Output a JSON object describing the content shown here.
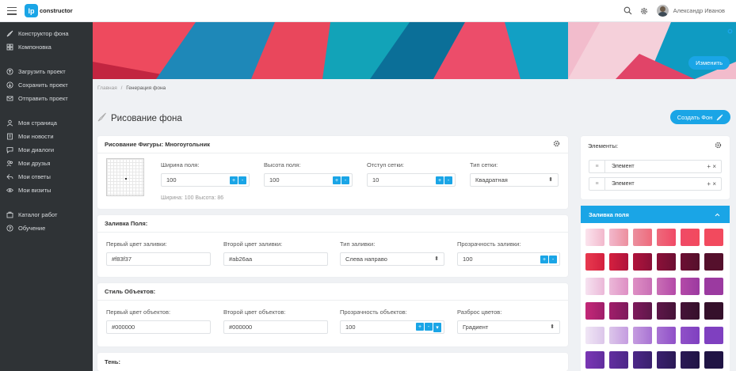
{
  "header": {
    "logo_letters": "lp",
    "logo_text": "constructor",
    "user_name": "Александр Иванов",
    "icons": [
      "search-icon",
      "settings-icon",
      "avatar"
    ]
  },
  "sidebar": {
    "items": [
      {
        "icon": "paint-brush-icon",
        "label": "Конструктор фона"
      },
      {
        "icon": "grid-icon",
        "label": "Компоновка"
      },
      {
        "icon": "upload-icon",
        "label": "Загрузить проект"
      },
      {
        "icon": "save-icon",
        "label": "Сохранить проект"
      },
      {
        "icon": "send-icon",
        "label": "Отправить проект"
      },
      {
        "icon": "user-icon",
        "label": "Моя страница"
      },
      {
        "icon": "news-icon",
        "label": "Мои новости"
      },
      {
        "icon": "chat-icon",
        "label": "Мои диалоги"
      },
      {
        "icon": "friends-icon",
        "label": "Мои друзья"
      },
      {
        "icon": "reply-icon",
        "label": "Мои ответы"
      },
      {
        "icon": "eye-icon",
        "label": "Мои визиты"
      },
      {
        "icon": "catalog-icon",
        "label": "Каталог работ"
      },
      {
        "icon": "help-icon",
        "label": "Обучение"
      }
    ]
  },
  "hero": {
    "change_button": "Изменить"
  },
  "breadcrumb": {
    "home": "Главная",
    "separator": "/",
    "current": "Генерация фона"
  },
  "page": {
    "title": "Рисование фона",
    "create_button": "Создать Фон"
  },
  "drawing": {
    "title": "Рисование Фигуры: Многоугольник",
    "field_width_label": "Ширина поля:",
    "field_width_value": "100",
    "field_height_label": "Высота поля:",
    "field_height_value": "100",
    "grid_offset_label": "Отступ сетки:",
    "grid_offset_value": "10",
    "grid_type_label": "Тип сетки:",
    "grid_type_value": "Квадратная",
    "size_hint": "Ширина: 100 Высота: 86"
  },
  "fill": {
    "title": "Заливка Поля:",
    "first_color_label": "Первый цвет заливки:",
    "first_color_value": "#f83f37",
    "second_color_label": "Второй цвет заливки:",
    "second_color_value": "#ab26aa",
    "fill_type_label": "Тип заливки:",
    "fill_type_value": "Слева направо",
    "opacity_label": "Прозрачность заливки:",
    "opacity_value": "100"
  },
  "objects": {
    "title": "Стиль Объектов:",
    "first_color_label": "Первый цвет объектов:",
    "first_color_value": "#000000",
    "second_color_label": "Второй цвет объектов:",
    "second_color_value": "#000000",
    "opacity_label": "Прозрачность объектов:",
    "opacity_value": "100",
    "spread_label": "Разброс цветов:",
    "spread_value": "Градиент"
  },
  "shadow": {
    "title": "Тень:"
  },
  "elements": {
    "title": "Элементы:",
    "items": [
      {
        "label": "Элемент"
      },
      {
        "label": "Элемент"
      }
    ]
  },
  "fill_panel": {
    "title": "Заливка поля"
  },
  "stepper": {
    "plus": "+",
    "minus": "-"
  },
  "select": {
    "arrow": "⬍"
  },
  "actions": {
    "add": "+",
    "remove": "×"
  },
  "colors": {
    "accent": "#1aa5e6",
    "sidebar_bg": "#2f3336",
    "page_bg": "#eff1f4"
  },
  "swatches": [
    [
      "#fbe4ee",
      "#f2b8cc",
      "#ec8f9e",
      "#ee6a7c",
      "#f04a66",
      "#f24a5e"
    ],
    [
      "#e83a4f",
      "#d4203f",
      "#b0133b",
      "#8b1038",
      "#6d0f33",
      "#55102c"
    ],
    [
      "#f6e2f0",
      "#ebb8d8",
      "#de8fc4",
      "#c96fb5",
      "#b44aa8",
      "#9b3aa0"
    ],
    [
      "#c42878",
      "#a01e6a",
      "#7e1a5c",
      "#5e1749",
      "#461338",
      "#35102b"
    ],
    [
      "#f0e6f5",
      "#dcc6ea",
      "#c59ce0",
      "#a873d3",
      "#9050c8",
      "#7f40c0"
    ],
    [
      "#7a36b4",
      "#622e9f",
      "#4c2788",
      "#3a206e",
      "#2b1a56",
      "#201444"
    ]
  ]
}
